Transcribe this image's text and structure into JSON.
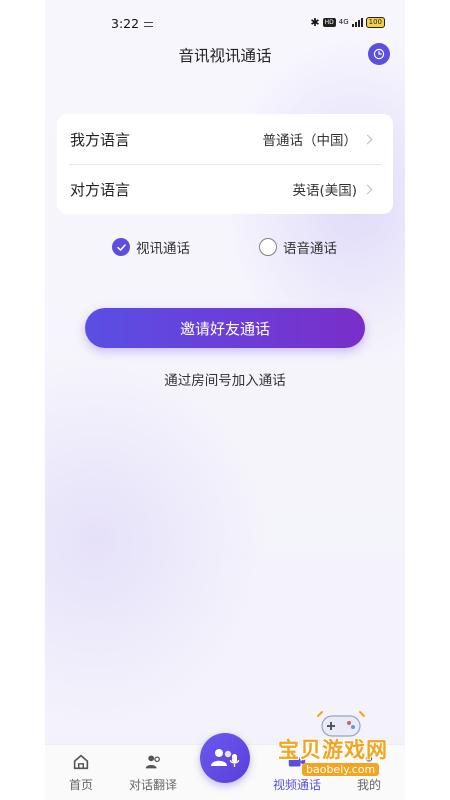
{
  "status_bar": {
    "time": "3:22",
    "network": "4G",
    "hd": "HD",
    "battery": "100"
  },
  "header": {
    "title": "音讯视讯通话"
  },
  "languages": {
    "mine_label": "我方语言",
    "mine_value": "普通话（中国）",
    "other_label": "对方语言",
    "other_value": "英语(美国)"
  },
  "call_type": {
    "video_label": "视讯通话",
    "voice_label": "语音通话",
    "selected": "video"
  },
  "invite_button": "邀请好友通话",
  "room_link": "通过房间号加入通话",
  "tabbar": {
    "home": "首页",
    "dialog": "对话翻译",
    "video": "视频通话",
    "mine": "我的",
    "active": "video"
  },
  "watermark": {
    "line1": "宝贝游戏网",
    "line2": "baobeiy.com"
  },
  "colors": {
    "accent": "#5b4fe0",
    "gradient_end": "#7a2ec8"
  }
}
